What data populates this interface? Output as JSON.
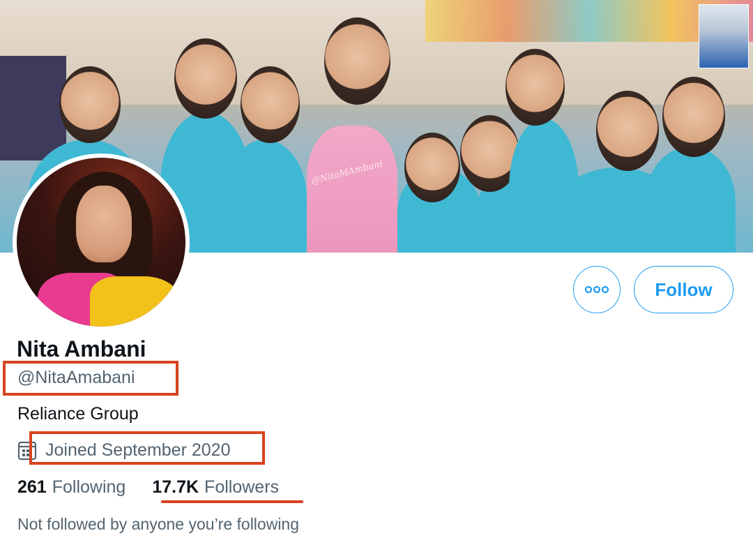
{
  "profile": {
    "name": "Nita Ambani",
    "handle": "@NitaAmabani",
    "bio": "Reliance Group",
    "joined": "Joined September 2020",
    "following_count": "261",
    "following_label": "Following",
    "followers_count": "17.7K",
    "followers_label": "Followers",
    "not_followed_text": "Not followed by anyone you’re following"
  },
  "banner": {
    "watermark": "@NitaMAmbani"
  },
  "actions": {
    "more_label": "•••",
    "follow_label": "Follow"
  },
  "colors": {
    "accent": "#1d9bf0",
    "annotation": "#d8431f",
    "secondary_text": "#536471",
    "primary_text": "#0f1419"
  }
}
